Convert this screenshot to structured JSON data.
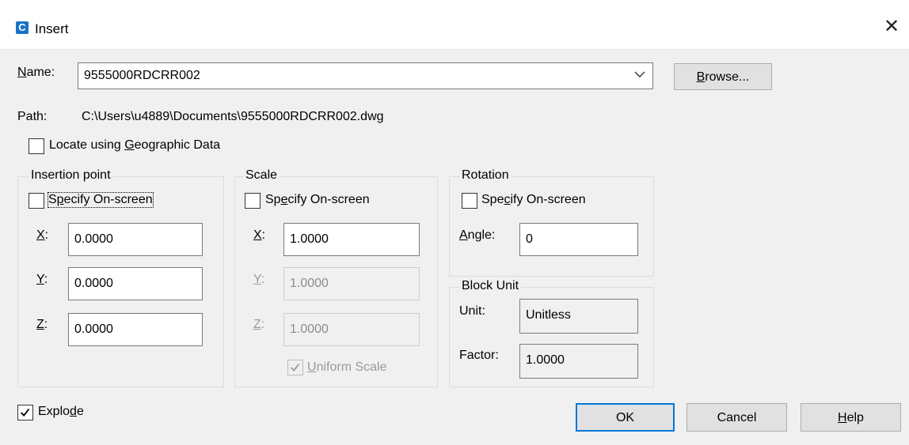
{
  "window": {
    "title": "Insert",
    "app_icon": "C",
    "close_symbol": "✕"
  },
  "name": {
    "label": "Name:",
    "value": "9555000RDCRR002",
    "browse": "Browse..."
  },
  "path": {
    "label": "Path:",
    "value": "C:\\Users\\u4889\\Documents\\9555000RDCRR002.dwg"
  },
  "geo": {
    "label": "Locate using Geographic Data",
    "checked": false
  },
  "insertion": {
    "legend": "Insertion point",
    "specify": "Specify On-screen",
    "x_label": "X:",
    "x": "0.0000",
    "y_label": "Y:",
    "y": "0.0000",
    "z_label": "Z:",
    "z": "0.0000"
  },
  "scale": {
    "legend": "Scale",
    "specify": "Specify On-screen",
    "x_label": "X:",
    "x": "1.0000",
    "y_label": "Y:",
    "y": "1.0000",
    "z_label": "Z:",
    "z": "1.0000",
    "uniform": "Uniform Scale",
    "uniform_checked": true
  },
  "rotation": {
    "legend": "Rotation",
    "specify": "Specify On-screen",
    "angle_label": "Angle:",
    "angle": "0"
  },
  "block_unit": {
    "legend": "Block Unit",
    "unit_label": "Unit:",
    "unit": "Unitless",
    "factor_label": "Factor:",
    "factor": "1.0000"
  },
  "explode": {
    "label": "Explode",
    "checked": true
  },
  "buttons": {
    "ok": "OK",
    "cancel": "Cancel",
    "help": "Help"
  },
  "colors": {
    "accent": "#0078d7",
    "app_icon": "#1a73c8",
    "background": "#f0f0f0"
  }
}
